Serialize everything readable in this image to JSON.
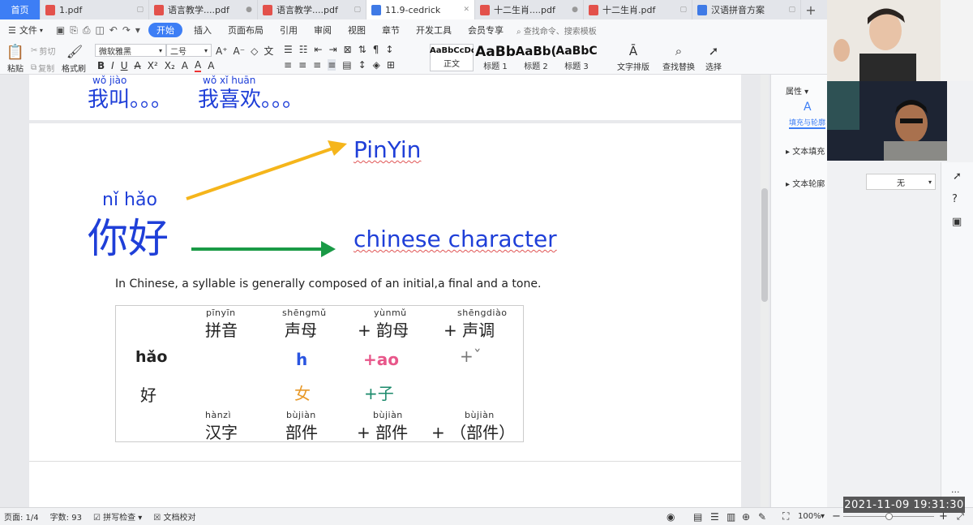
{
  "tabs": [
    {
      "label": "首页",
      "type": "home"
    },
    {
      "label": "1.pdf",
      "type": "pdf"
    },
    {
      "label": "语言教学....pdf",
      "type": "pdf"
    },
    {
      "label": "语言教学....pdf",
      "type": "pdf"
    },
    {
      "label": "11.9-cedrick",
      "type": "doc"
    },
    {
      "label": "十二生肖....pdf",
      "type": "pdf"
    },
    {
      "label": "十二生肖.pdf",
      "type": "pdf"
    },
    {
      "label": "汉语拼音方案",
      "type": "doc"
    }
  ],
  "new_tab": "+",
  "menubar": {
    "file": "文件",
    "items": [
      "开始",
      "插入",
      "页面布局",
      "引用",
      "审阅",
      "视图",
      "章节",
      "开发工具",
      "会员专享"
    ],
    "active": "开始",
    "search_placeholder": "查找命令、搜索模板"
  },
  "ribbon": {
    "paste": "粘贴",
    "cut": "剪切",
    "copy": "复制",
    "format_painter": "格式刷",
    "font_name": "微软雅黑",
    "font_size": "二号",
    "styles": [
      {
        "preview": "AaBbCcDd",
        "name": "正文"
      },
      {
        "preview": "AaBb",
        "name": "标题 1"
      },
      {
        "preview": "AaBb(",
        "name": "标题 2"
      },
      {
        "preview": "AaBbC",
        "name": "标题 3"
      }
    ],
    "text_layout": "文字排版",
    "find_replace": "查找替换",
    "select": "选择"
  },
  "doc": {
    "top_left": {
      "pinyin": "wǒ jiào",
      "hanzi": "我叫。。。"
    },
    "top_right": {
      "pinyin": "wǒ xǐ huān",
      "hanzi": "我喜欢。。。"
    },
    "nihao_pinyin": "nǐ hǎo",
    "nihao_hanzi": "你好",
    "label_pinyin": "PinYin",
    "label_character": "chinese character",
    "sentence": "In Chinese, a syllable is generally composed of an initial,a final and a tone.",
    "table": {
      "headers": [
        {
          "py": "pīnyīn",
          "hz": "拼音"
        },
        {
          "py": "shēngmǔ",
          "hz": "声母"
        },
        {
          "py": "yùnmǔ",
          "hz": "+ 韵母"
        },
        {
          "py": "shēngdiào",
          "hz": "+ 声调"
        }
      ],
      "row1": {
        "label": "hǎo",
        "initial": "h",
        "final": "+ao",
        "tone": "+ˇ"
      },
      "row2": {
        "label": "好",
        "radical1": "女",
        "radical2": "+子"
      },
      "footer": [
        {
          "py": "hànzì",
          "hz": "汉字"
        },
        {
          "py": "bùjiàn",
          "hz": "部件"
        },
        {
          "py": "bùjiàn",
          "hz": "+ 部件"
        },
        {
          "py": "bùjiàn",
          "hz": "+ （部件）"
        }
      ]
    }
  },
  "props": {
    "title": "属性",
    "tab_fill": "填充与轮廓",
    "text_fill": "文本填充",
    "text_outline": "文本轮廓",
    "outline_value": "无"
  },
  "status": {
    "page": "页面: 1/4",
    "words": "字数: 93",
    "spell": "拼写检查",
    "proof": "文档校对",
    "zoom": "100%"
  },
  "timestamp": "2021-11-09  19:31:30",
  "colors": {
    "accent": "#3d7ef5",
    "doc_blue": "#1f3fd8",
    "arrow_yellow": "#f5b51b",
    "arrow_green": "#1a9a46",
    "pink": "#e8578a",
    "orange": "#e89a2a",
    "teal": "#1b8a6b"
  }
}
